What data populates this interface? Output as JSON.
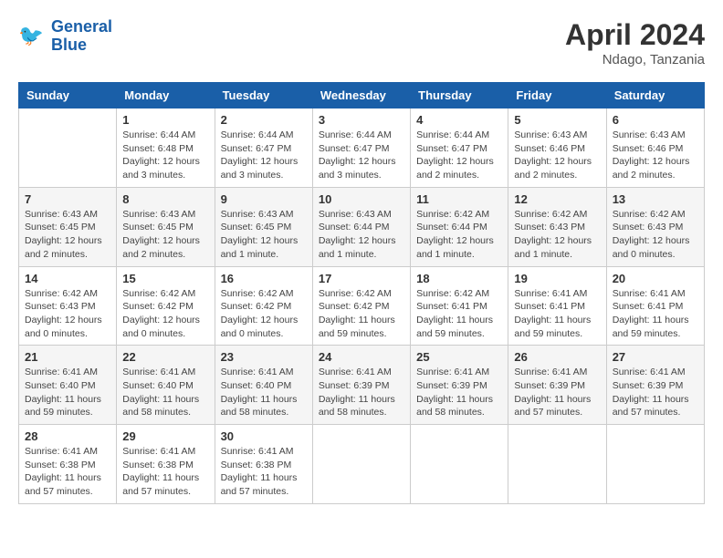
{
  "header": {
    "logo_line1": "General",
    "logo_line2": "Blue",
    "month_title": "April 2024",
    "location": "Ndago, Tanzania"
  },
  "weekdays": [
    "Sunday",
    "Monday",
    "Tuesday",
    "Wednesday",
    "Thursday",
    "Friday",
    "Saturday"
  ],
  "weeks": [
    [
      {
        "day": "",
        "info": ""
      },
      {
        "day": "1",
        "info": "Sunrise: 6:44 AM\nSunset: 6:48 PM\nDaylight: 12 hours\nand 3 minutes."
      },
      {
        "day": "2",
        "info": "Sunrise: 6:44 AM\nSunset: 6:47 PM\nDaylight: 12 hours\nand 3 minutes."
      },
      {
        "day": "3",
        "info": "Sunrise: 6:44 AM\nSunset: 6:47 PM\nDaylight: 12 hours\nand 3 minutes."
      },
      {
        "day": "4",
        "info": "Sunrise: 6:44 AM\nSunset: 6:47 PM\nDaylight: 12 hours\nand 2 minutes."
      },
      {
        "day": "5",
        "info": "Sunrise: 6:43 AM\nSunset: 6:46 PM\nDaylight: 12 hours\nand 2 minutes."
      },
      {
        "day": "6",
        "info": "Sunrise: 6:43 AM\nSunset: 6:46 PM\nDaylight: 12 hours\nand 2 minutes."
      }
    ],
    [
      {
        "day": "7",
        "info": "Sunrise: 6:43 AM\nSunset: 6:45 PM\nDaylight: 12 hours\nand 2 minutes."
      },
      {
        "day": "8",
        "info": "Sunrise: 6:43 AM\nSunset: 6:45 PM\nDaylight: 12 hours\nand 2 minutes."
      },
      {
        "day": "9",
        "info": "Sunrise: 6:43 AM\nSunset: 6:45 PM\nDaylight: 12 hours\nand 1 minute."
      },
      {
        "day": "10",
        "info": "Sunrise: 6:43 AM\nSunset: 6:44 PM\nDaylight: 12 hours\nand 1 minute."
      },
      {
        "day": "11",
        "info": "Sunrise: 6:42 AM\nSunset: 6:44 PM\nDaylight: 12 hours\nand 1 minute."
      },
      {
        "day": "12",
        "info": "Sunrise: 6:42 AM\nSunset: 6:43 PM\nDaylight: 12 hours\nand 1 minute."
      },
      {
        "day": "13",
        "info": "Sunrise: 6:42 AM\nSunset: 6:43 PM\nDaylight: 12 hours\nand 0 minutes."
      }
    ],
    [
      {
        "day": "14",
        "info": "Sunrise: 6:42 AM\nSunset: 6:43 PM\nDaylight: 12 hours\nand 0 minutes."
      },
      {
        "day": "15",
        "info": "Sunrise: 6:42 AM\nSunset: 6:42 PM\nDaylight: 12 hours\nand 0 minutes."
      },
      {
        "day": "16",
        "info": "Sunrise: 6:42 AM\nSunset: 6:42 PM\nDaylight: 12 hours\nand 0 minutes."
      },
      {
        "day": "17",
        "info": "Sunrise: 6:42 AM\nSunset: 6:42 PM\nDaylight: 11 hours\nand 59 minutes."
      },
      {
        "day": "18",
        "info": "Sunrise: 6:42 AM\nSunset: 6:41 PM\nDaylight: 11 hours\nand 59 minutes."
      },
      {
        "day": "19",
        "info": "Sunrise: 6:41 AM\nSunset: 6:41 PM\nDaylight: 11 hours\nand 59 minutes."
      },
      {
        "day": "20",
        "info": "Sunrise: 6:41 AM\nSunset: 6:41 PM\nDaylight: 11 hours\nand 59 minutes."
      }
    ],
    [
      {
        "day": "21",
        "info": "Sunrise: 6:41 AM\nSunset: 6:40 PM\nDaylight: 11 hours\nand 59 minutes."
      },
      {
        "day": "22",
        "info": "Sunrise: 6:41 AM\nSunset: 6:40 PM\nDaylight: 11 hours\nand 58 minutes."
      },
      {
        "day": "23",
        "info": "Sunrise: 6:41 AM\nSunset: 6:40 PM\nDaylight: 11 hours\nand 58 minutes."
      },
      {
        "day": "24",
        "info": "Sunrise: 6:41 AM\nSunset: 6:39 PM\nDaylight: 11 hours\nand 58 minutes."
      },
      {
        "day": "25",
        "info": "Sunrise: 6:41 AM\nSunset: 6:39 PM\nDaylight: 11 hours\nand 58 minutes."
      },
      {
        "day": "26",
        "info": "Sunrise: 6:41 AM\nSunset: 6:39 PM\nDaylight: 11 hours\nand 57 minutes."
      },
      {
        "day": "27",
        "info": "Sunrise: 6:41 AM\nSunset: 6:39 PM\nDaylight: 11 hours\nand 57 minutes."
      }
    ],
    [
      {
        "day": "28",
        "info": "Sunrise: 6:41 AM\nSunset: 6:38 PM\nDaylight: 11 hours\nand 57 minutes."
      },
      {
        "day": "29",
        "info": "Sunrise: 6:41 AM\nSunset: 6:38 PM\nDaylight: 11 hours\nand 57 minutes."
      },
      {
        "day": "30",
        "info": "Sunrise: 6:41 AM\nSunset: 6:38 PM\nDaylight: 11 hours\nand 57 minutes."
      },
      {
        "day": "",
        "info": ""
      },
      {
        "day": "",
        "info": ""
      },
      {
        "day": "",
        "info": ""
      },
      {
        "day": "",
        "info": ""
      }
    ]
  ]
}
